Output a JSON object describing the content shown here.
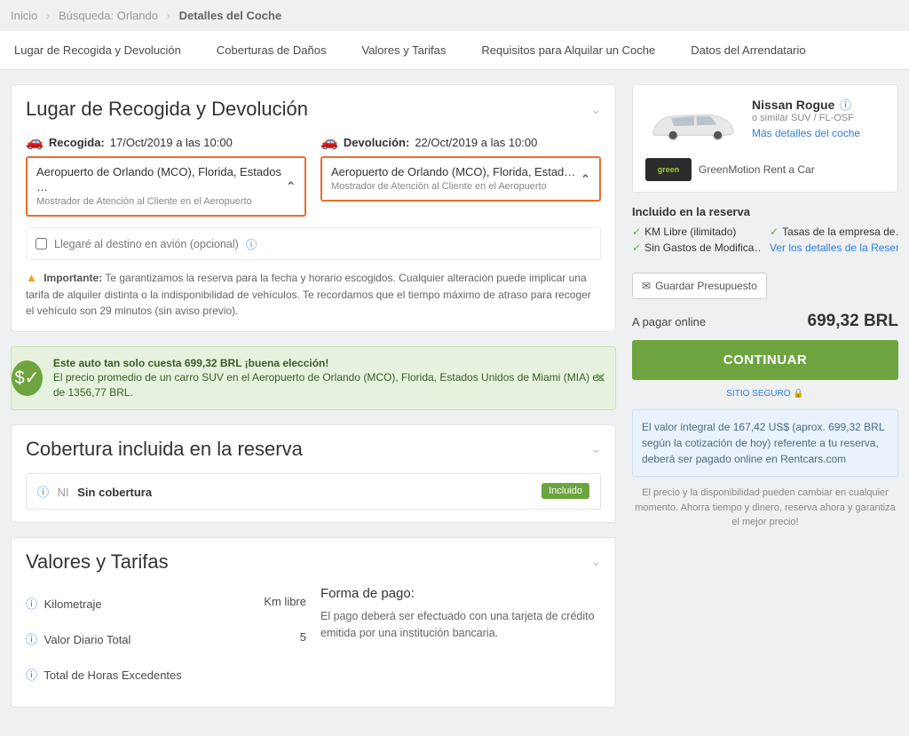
{
  "breadcrumb": {
    "home": "Inicio",
    "search": "Búsqueda: Orlando",
    "current": "Detalles del Coche"
  },
  "tabs": [
    "Lugar de Recogida y Devolución",
    "Coberturas de Daños",
    "Valores y Tarifas",
    "Requisitos para Alquilar un Coche",
    "Datos del Arrendatario"
  ],
  "pickup_section": {
    "title": "Lugar de Recogida y Devolución",
    "pickup_label": "Recogida:",
    "pickup_time": "17/Oct/2019 a las 10:00",
    "dropoff_label": "Devolución:",
    "dropoff_time": "22/Oct/2019 a las 10:00",
    "pickup_loc": "Aeropuerto de Orlando (MCO), Florida, Estados …",
    "pickup_desk": "Mostrador de Atención al Cliente en el Aeropuerto",
    "dropoff_loc": "Aeropuerto de Orlando (MCO), Florida, Estad…",
    "dropoff_desk": "Mostrador de Atención al Cliente en el Aeropuerto",
    "plane_opt": "Llegaré al destino en avión (opcional)",
    "important_label": "Importante:",
    "important_text": "Te garantizamos la reserva para la fecha y horario escogidos. Cualquier alteración puede implicar una tarifa de alquiler distinta o la indisponibilidad de vehículos. Te recordamos que el tiempo máximo de atraso para recoger el vehículo son 29 minutos (sin aviso previo)."
  },
  "deal": {
    "headline": "Este auto tan solo cuesta 699,32 BRL ¡buena elección!",
    "body": "El precio promedio de un carro SUV en el Aeropuerto de Orlando (MCO), Florida, Estados Unidos de Miami (MIA) es de 1356,77 BRL."
  },
  "coverage": {
    "title": "Cobertura incluida en la reserva",
    "ni": "NI",
    "label": "Sin cobertura",
    "badge": "Incluido"
  },
  "rates": {
    "title": "Valores y Tarifas",
    "items": [
      {
        "label": "Kilometraje",
        "value": "Km libre"
      },
      {
        "label": "Valor Diario Total",
        "value": "5"
      },
      {
        "label": "Total de Horas Excedentes",
        "value": ""
      }
    ],
    "payment_title": "Forma de pago:",
    "payment_text": "El pago deberá ser efectuado con una tarjeta de crédito emitida por una institución bancaria."
  },
  "car": {
    "name": "Nissan Rogue",
    "sub": "o similar SUV / FL-OSF",
    "more": "Más detalles del coche",
    "brand_logo": "green",
    "brand": "GreenMotion Rent a Car"
  },
  "included": {
    "title": "Incluido en la reserva",
    "km": "KM Libre (ilimitado)",
    "tax": "Tasas de la empresa de…",
    "mod": "Sin Gastos de Modifica…",
    "details": "Ver los detalles de la Reserva"
  },
  "save": "Guardar Presupuesto",
  "pay": {
    "label": "A pagar online",
    "amount": "699,32 BRL"
  },
  "cta": "CONTINUAR",
  "secure": "SITIO SEGURO",
  "valbox": "El valor integral de 167,42 US$ (aprox. 699,32 BRL según la cotización de hoy) referente a tu reserva, deberá ser pagado online en Rentcars.com",
  "disclaimer": "El precio y la disponibilidad pueden cambiar en cualquier momento. Ahorra tiempo y dinero, reserva ahora y garantiza el mejor precio!"
}
